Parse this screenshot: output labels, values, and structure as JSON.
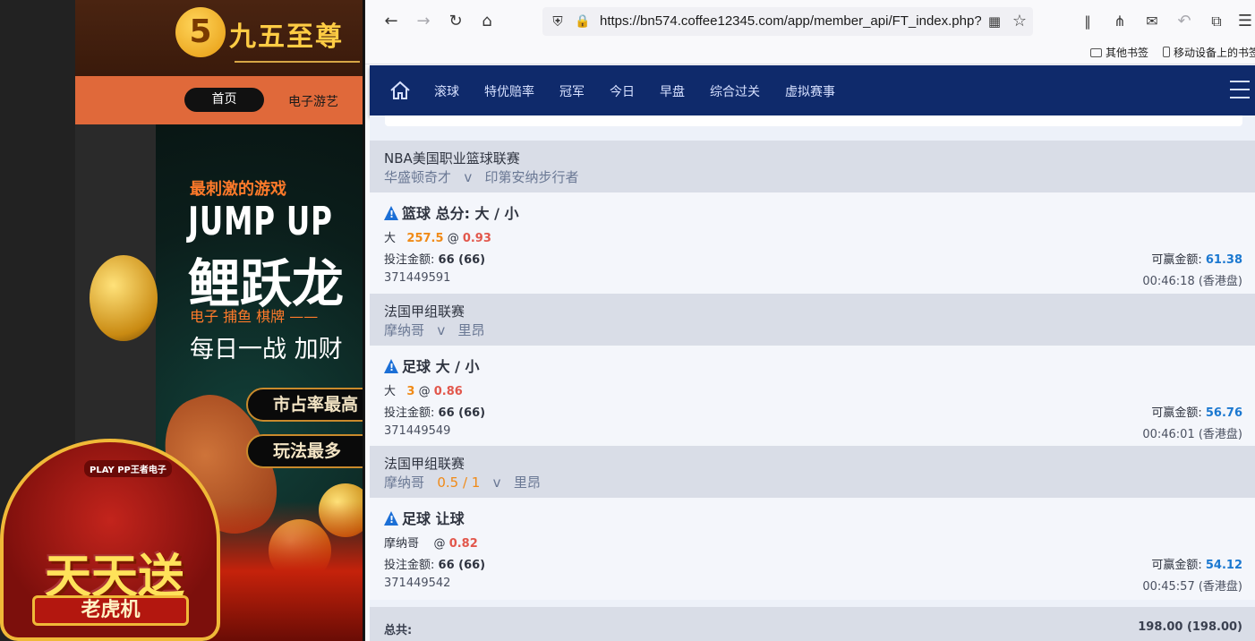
{
  "left_site": {
    "logo_glyph": "5",
    "logo_text": "九五至尊",
    "nav_home": "首页",
    "nav_slots": "电子游艺",
    "banner_tag": "最刺激的游戏",
    "banner_title": "JUMP UP",
    "banner_subtitle": "鲤跃龙",
    "banner_categories": "电子  捕鱼  棋牌 ——",
    "banner_slogan": "每日一战  加财",
    "pill_1": "市占率最高",
    "pill_2": "玩法最多",
    "promo_brand": "PLAY PP王者电子",
    "promo_big": "天天送",
    "promo_sub": "老虎机"
  },
  "browser": {
    "url": "https://bn574.coffee12345.com/app/member_api/FT_index.php?",
    "bookmarks": [
      "其他书签",
      "移动设备上的书签"
    ]
  },
  "site_nav": {
    "items": [
      "滚球",
      "特优赔率",
      "冠军",
      "今日",
      "早盘",
      "综合过关",
      "虚拟赛事"
    ]
  },
  "bets": [
    {
      "league": "NBA美国职业篮球联赛",
      "home": "华盛顿奇才",
      "vs": "v",
      "away": "印第安纳步行者",
      "handicap_line": "",
      "title": "篮球 总分: 大 / 小",
      "pick": "大",
      "pick_value": "257.5",
      "at": "@",
      "odds": "0.93",
      "stake_label": "投注金额:",
      "stake": "66 (66)",
      "win_label": "可赢金额:",
      "win": "61.38",
      "ticket_id": "371449591",
      "time": "00:46:18 (香港盘)"
    },
    {
      "league": "法国甲组联赛",
      "home": "摩纳哥",
      "vs": "v",
      "away": "里昂",
      "handicap_line": "",
      "title": "足球 大 / 小",
      "pick": "大",
      "pick_value": "3",
      "at": "@",
      "odds": "0.86",
      "stake_label": "投注金额:",
      "stake": "66 (66)",
      "win_label": "可赢金额:",
      "win": "56.76",
      "ticket_id": "371449549",
      "time": "00:46:01 (香港盘)"
    },
    {
      "league": "法国甲组联赛",
      "home": "摩纳哥",
      "vs": "v",
      "away": "里昂",
      "handicap_line": "0.5 / 1",
      "title": "足球 让球",
      "pick": "摩纳哥",
      "pick_value": "",
      "at": "@",
      "odds": "0.82",
      "stake_label": "投注金额:",
      "stake": "66 (66)",
      "win_label": "可赢金额:",
      "win": "54.12",
      "ticket_id": "371449542",
      "time": "00:45:57 (香港盘)"
    }
  ],
  "totals": {
    "label": "总共:",
    "value": "198.00 (198.00)"
  }
}
